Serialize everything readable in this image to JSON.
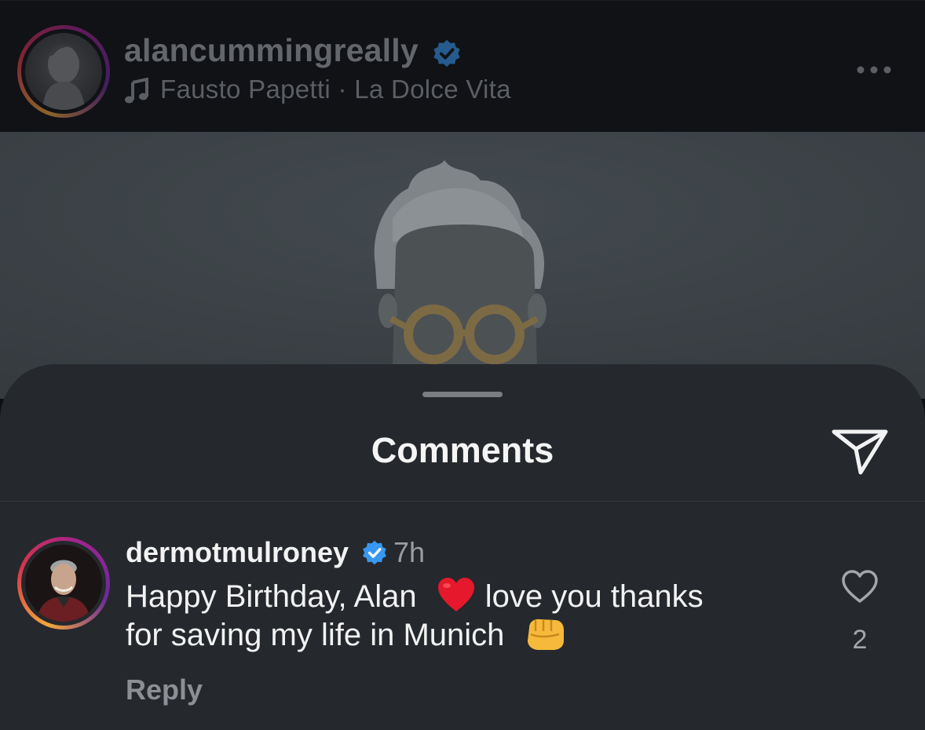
{
  "post": {
    "username": "alancummingreally",
    "verified": true,
    "audio": "Fausto Papetti · La Dolce Vita",
    "icons": {
      "music": "music-note-icon",
      "more": "more-options-icon",
      "verified": "verified-badge-icon"
    }
  },
  "comments_sheet": {
    "title": "Comments",
    "icons": {
      "share": "paper-plane-icon",
      "grab": "grab-handle"
    },
    "comments": [
      {
        "username": "dermotmulroney",
        "verified": true,
        "time": "7h",
        "text_line1_a": "Happy Birthday, Alan",
        "text_line1_emoji": "red-heart-emoji",
        "text_line1_b": "love you  thanks",
        "text_line2": "for saving my life in Munich",
        "text_line2_emoji": "oncoming-fist-emoji",
        "reply_label": "Reply",
        "like_count": "2",
        "like_icon": "heart-outline-icon"
      }
    ]
  },
  "colors": {
    "sheet_background": "#25282c",
    "verified_blue": "#3897f0",
    "avatar_ring_start": "#f2a73b",
    "avatar_ring_end": "#a0238f"
  }
}
